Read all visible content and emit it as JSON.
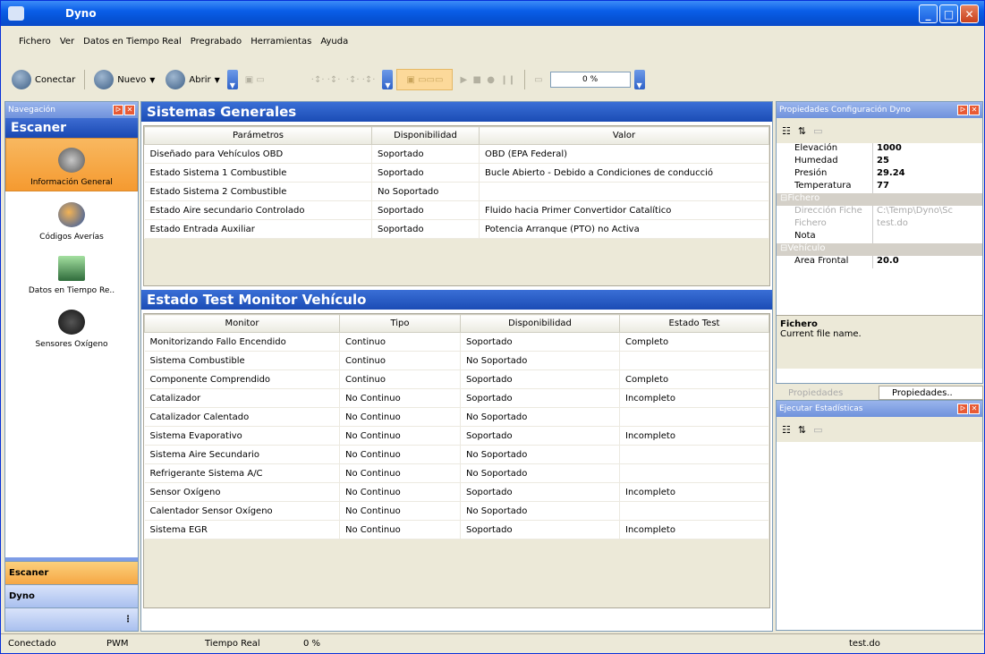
{
  "window": {
    "title": "Dyno"
  },
  "menu": [
    "Fichero",
    "Ver",
    "Datos en Tiempo Real",
    "Pregrabado",
    "Herramientas",
    "Ayuda"
  ],
  "toolbar": {
    "connect": "Conectar",
    "new": "Nuevo",
    "open": "Abrir",
    "progress": "0 %"
  },
  "nav": {
    "panel_title": "Navegación",
    "section": "Escaner",
    "items": [
      "Información General",
      "Códigos Averías",
      "Datos en Tiempo Re..",
      "Sensores Oxígeno"
    ],
    "bottom": [
      "Escaner",
      "Dyno"
    ]
  },
  "systems": {
    "title": "Sistemas Generales",
    "headers": [
      "Parámetros",
      "Disponibilidad",
      "Valor"
    ],
    "rows": [
      [
        "Diseñado para Vehículos OBD",
        "Soportado",
        "OBD (EPA Federal)"
      ],
      [
        "Estado Sistema 1 Combustible",
        "Soportado",
        "Bucle Abierto - Debido a Condiciones de conducció"
      ],
      [
        "Estado Sistema 2 Combustible",
        "No Soportado",
        ""
      ],
      [
        "Estado Aire secundario Controlado",
        "Soportado",
        "Fluido hacia Primer Convertidor Catalítico"
      ],
      [
        "Estado Entrada Auxiliar",
        "Soportado",
        "Potencia Arranque (PTO) no Activa"
      ]
    ]
  },
  "monitor": {
    "title": "Estado Test Monitor Vehículo",
    "headers": [
      "Monitor",
      "Tipo",
      "Disponibilidad",
      "Estado Test"
    ],
    "rows": [
      [
        "Monitorizando Fallo Encendido",
        "Continuo",
        "Soportado",
        "Completo"
      ],
      [
        "Sistema Combustible",
        "Continuo",
        "No Soportado",
        ""
      ],
      [
        "Componente Comprendido",
        "Continuo",
        "Soportado",
        "Completo"
      ],
      [
        "Catalizador",
        "No Continuo",
        "Soportado",
        "Incompleto"
      ],
      [
        "Catalizador Calentado",
        "No Continuo",
        "No Soportado",
        ""
      ],
      [
        "Sistema Evaporativo",
        "No Continuo",
        "Soportado",
        "Incompleto"
      ],
      [
        "Sistema Aire Secundario",
        "No Continuo",
        "No Soportado",
        ""
      ],
      [
        "Refrigerante Sistema A/C",
        "No Continuo",
        "No Soportado",
        ""
      ],
      [
        "Sensor Oxígeno",
        "No Continuo",
        "Soportado",
        "Incompleto"
      ],
      [
        "Calentador Sensor Oxígeno",
        "No Continuo",
        "No Soportado",
        ""
      ],
      [
        "Sistema EGR",
        "No Continuo",
        "Soportado",
        "Incompleto"
      ]
    ]
  },
  "props": {
    "title": "Propiedades Configuración Dyno",
    "rows": [
      [
        "Elevación",
        "1000"
      ],
      [
        "Humedad",
        "25"
      ],
      [
        "Presión",
        "29.24"
      ],
      [
        "Temperatura",
        "77"
      ]
    ],
    "cat1": "Fichero",
    "gray": [
      [
        "Dirección Fiche",
        "C:\\Temp\\Dyno\\Sc"
      ],
      [
        "Fichero",
        "test.do"
      ]
    ],
    "nota": "Nota",
    "cat2": "Vehículo",
    "area": [
      "Area Frontal",
      "20.0"
    ],
    "desc_title": "Fichero",
    "desc_text": "Current file name.",
    "tab1": "Propiedades",
    "tab2": "Propiedades.."
  },
  "stats": {
    "title": "Ejecutar Estadísticas"
  },
  "status": [
    "Conectado",
    "PWM",
    "Tiempo Real",
    "0 %",
    "test.do"
  ]
}
